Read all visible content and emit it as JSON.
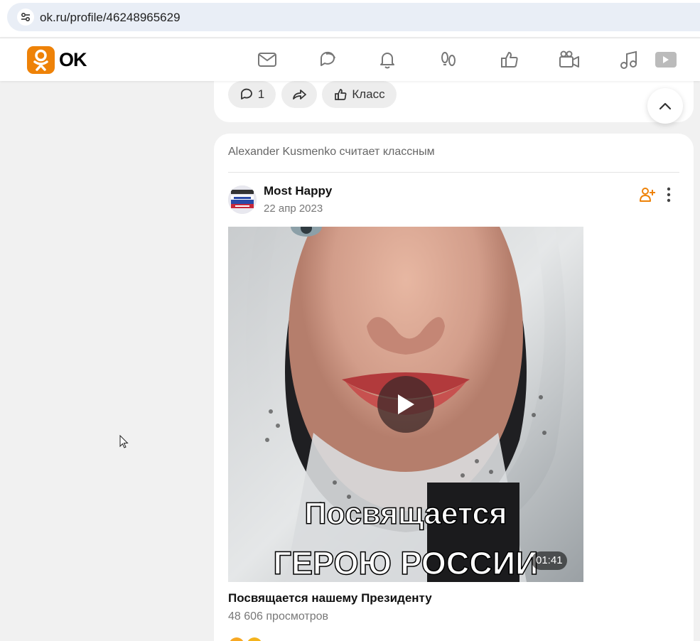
{
  "browser": {
    "url": "ok.ru/profile/46248965629"
  },
  "header": {
    "logo_text": "OK",
    "nav_icons": [
      "mail-icon",
      "chat-icon",
      "bell-icon",
      "guests-icon",
      "likes-icon",
      "video-camera-icon",
      "music-icon",
      "video-play-icon"
    ]
  },
  "previous_post": {
    "comment_count": "1",
    "like_label": "Класс"
  },
  "feed_post": {
    "liked_by_text": "Alexander Kusmenko считает классным",
    "author": "Most Happy",
    "date": "22 апр 2023",
    "video": {
      "caption_line_1": "Посвящается",
      "caption_line_2": "ГЕРОЮ РОССИИ",
      "duration": "01:41"
    },
    "title": "Посвящается нашему Президенту",
    "views": "48 606 просмотров"
  },
  "colors": {
    "brand": "#ee8208",
    "background": "#f1f1f1",
    "card": "#ffffff",
    "icon_gray": "#777777"
  }
}
